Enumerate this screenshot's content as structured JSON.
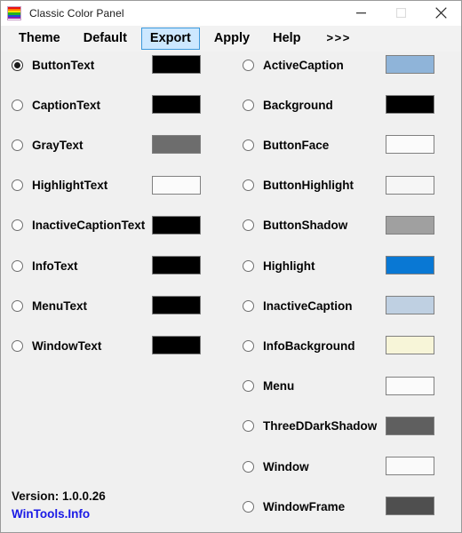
{
  "window": {
    "title": "Classic Color Panel",
    "icon": "rainbow-palette-icon",
    "icon_stripes": [
      "#e81111",
      "#ff7a00",
      "#ffe400",
      "#22b422",
      "#1a4fd6",
      "#8a1fb0"
    ],
    "controls": {
      "minimize": "minimize-icon",
      "maximize": "maximize-icon",
      "close": "close-icon"
    }
  },
  "menubar": {
    "items": [
      {
        "label": "Theme",
        "selected": false
      },
      {
        "label": "Default",
        "selected": false
      },
      {
        "label": "Export",
        "selected": true
      },
      {
        "label": "Apply",
        "selected": false
      },
      {
        "label": "Help",
        "selected": false
      },
      {
        "label": ">>>",
        "selected": false
      }
    ]
  },
  "left_column": [
    {
      "label": "ButtonText",
      "color": "#000000",
      "selected": true
    },
    {
      "label": "CaptionText",
      "color": "#000000",
      "selected": false
    },
    {
      "label": "GrayText",
      "color": "#6d6d6d",
      "selected": false
    },
    {
      "label": "HighlightText",
      "color": "#fbfbfb",
      "selected": false
    },
    {
      "label": "InactiveCaptionText",
      "color": "#000000",
      "selected": false
    },
    {
      "label": "InfoText",
      "color": "#000000",
      "selected": false
    },
    {
      "label": "MenuText",
      "color": "#000000",
      "selected": false
    },
    {
      "label": "WindowText",
      "color": "#000000",
      "selected": false
    }
  ],
  "right_column": [
    {
      "label": "ActiveCaption",
      "color": "#8fb4d9",
      "selected": false
    },
    {
      "label": "Background",
      "color": "#000000",
      "selected": false
    },
    {
      "label": "ButtonFace",
      "color": "#fbfbfb",
      "selected": false
    },
    {
      "label": "ButtonHighlight",
      "color": "#f6f6f6",
      "selected": false
    },
    {
      "label": "ButtonShadow",
      "color": "#a0a0a0",
      "selected": false
    },
    {
      "label": "Highlight",
      "color": "#0978d4",
      "selected": false
    },
    {
      "label": "InactiveCaption",
      "color": "#bfd0e2",
      "selected": false
    },
    {
      "label": "InfoBackground",
      "color": "#f7f5d8",
      "selected": false
    },
    {
      "label": "Menu",
      "color": "#fbfbfb",
      "selected": false
    },
    {
      "label": "ThreeDDarkShadow",
      "color": "#5f5f5f",
      "selected": false
    },
    {
      "label": "Window",
      "color": "#fafafa",
      "selected": false
    },
    {
      "label": "WindowFrame",
      "color": "#4f4f4f",
      "selected": false
    }
  ],
  "footer": {
    "version": "Version: 1.0.0.26",
    "link": "WinTools.Info"
  }
}
